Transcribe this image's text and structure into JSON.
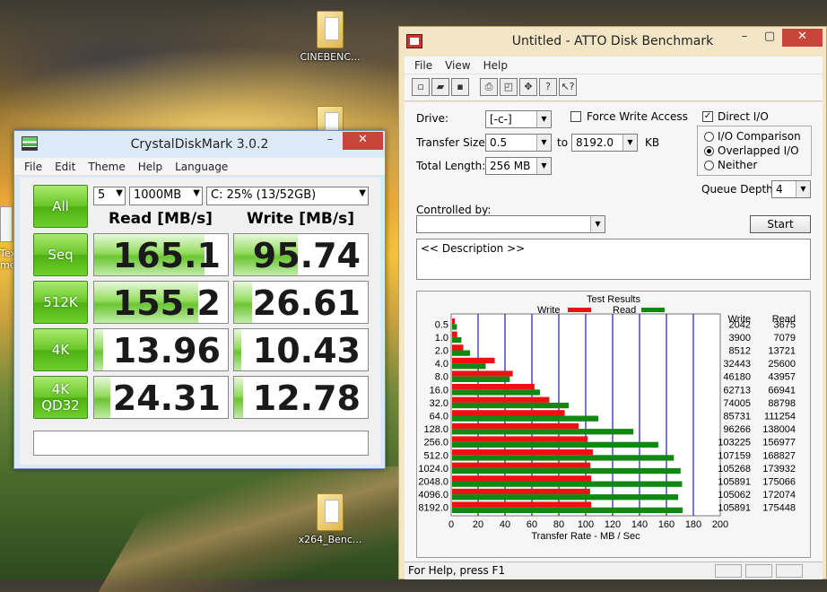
{
  "desktop": {
    "icons": [
      {
        "label": "CINEBENC..."
      },
      {
        "label": ""
      },
      {
        "label": "x264_Benc..."
      }
    ],
    "side_text": "Tex\nme"
  },
  "cdm": {
    "title": "CrystalDiskMark 3.0.2",
    "menu": [
      "File",
      "Edit",
      "Theme",
      "Help",
      "Language"
    ],
    "all_button": "All",
    "count": "5",
    "size": "1000MB",
    "drive": "C: 25% (13/52GB)",
    "read_header": "Read [MB/s]",
    "write_header": "Write [MB/s]",
    "rows": [
      {
        "label": "Seq",
        "label2": "",
        "read": "165.1",
        "write": "95.74",
        "read_v": 165.1,
        "write_v": 95.74
      },
      {
        "label": "512K",
        "label2": "",
        "read": "155.2",
        "write": "26.61",
        "read_v": 155.2,
        "write_v": 26.61
      },
      {
        "label": "4K",
        "label2": "",
        "read": "13.96",
        "write": "10.43",
        "read_v": 13.96,
        "write_v": 10.43
      },
      {
        "label": "4K",
        "label2": "QD32",
        "read": "24.31",
        "write": "12.78",
        "read_v": 24.31,
        "write_v": 12.78
      }
    ],
    "comment": ""
  },
  "atto": {
    "title": "Untitled - ATTO Disk Benchmark",
    "menu": [
      "File",
      "View",
      "Help"
    ],
    "drive_label": "Drive:",
    "drive_value": "[-c-]",
    "transfer_size_label": "Transfer Size:",
    "transfer_from": "0.5",
    "to_label": "to",
    "transfer_to": "8192.0",
    "kb_label": "KB",
    "total_length_label": "Total Length:",
    "total_length_value": "256 MB",
    "force_write_label": "Force Write Access",
    "direct_io_label": "Direct I/O",
    "io_comparison_label": "I/O Comparison",
    "overlapped_io_label": "Overlapped I/O",
    "neither_label": "Neither",
    "queue_depth_label": "Queue Depth:",
    "queue_depth_value": "4",
    "controlled_by_label": "Controlled by:",
    "controlled_by_value": "",
    "start_button": "Start",
    "description": "<< Description >>",
    "results_title": "Test Results",
    "legend_write": "Write",
    "legend_read": "Read",
    "col_write": "Write",
    "col_read": "Read",
    "xlabel": "Transfer Rate - MB / Sec",
    "status": "For Help, press F1",
    "colors": {
      "write": "#ee1111",
      "read": "#118811",
      "grid": "#1a1ab8"
    }
  },
  "chart_data": {
    "type": "bar",
    "title": "Test Results",
    "categories": [
      "0.5",
      "1.0",
      "2.0",
      "4.0",
      "8.0",
      "16.0",
      "32.0",
      "64.0",
      "128.0",
      "256.0",
      "512.0",
      "1024.0",
      "2048.0",
      "4096.0",
      "8192.0"
    ],
    "series": [
      {
        "name": "Write",
        "values": [
          2042,
          3900,
          8512,
          32443,
          46180,
          62713,
          74005,
          85731,
          96266,
          103225,
          107159,
          105268,
          105891,
          105062,
          105891
        ]
      },
      {
        "name": "Read",
        "values": [
          3675,
          7079,
          13721,
          25600,
          43957,
          66941,
          88798,
          111254,
          138004,
          156977,
          168827,
          173932,
          175066,
          172074,
          175448
        ]
      }
    ],
    "xlabel": "Transfer Rate - MB / Sec",
    "xlim": [
      0,
      200
    ],
    "xticks": [
      "0",
      "20",
      "40",
      "60",
      "80",
      "100",
      "120",
      "140",
      "160",
      "180",
      "200"
    ],
    "orientation": "horizontal",
    "legend": "top"
  }
}
